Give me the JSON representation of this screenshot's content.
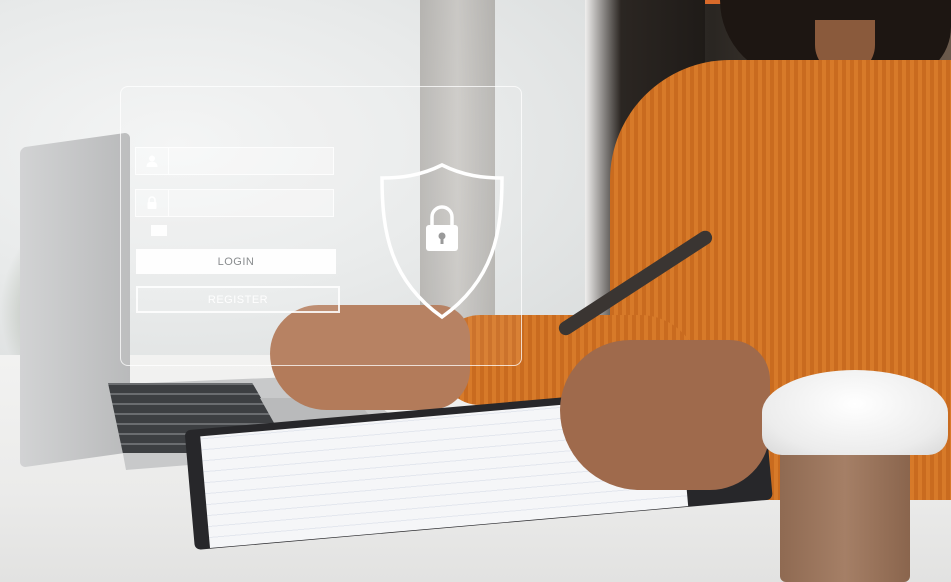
{
  "login_overlay": {
    "username_field": {
      "icon": "user-icon",
      "placeholder": ""
    },
    "password_field": {
      "icon": "lock-icon",
      "placeholder": ""
    },
    "remember_checkbox": {
      "checked": false
    },
    "login_button_label": "LOGIN",
    "register_button_label": "REGISTER",
    "security_icon": "shield-lock-icon"
  },
  "colors": {
    "accent_bar": "#d86a2a",
    "overlay_line": "#ffffff"
  }
}
